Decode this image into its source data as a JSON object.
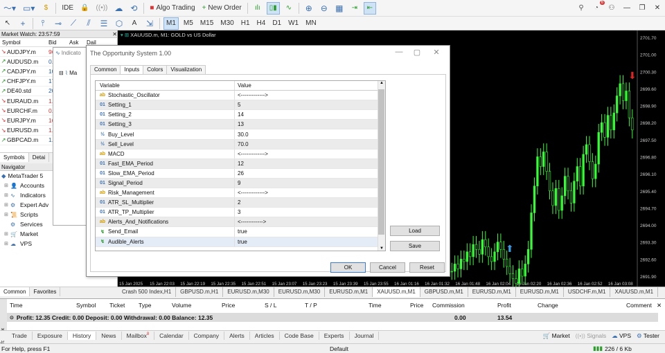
{
  "toolbar": {
    "ide_label": "IDE",
    "algo_trading_label": "Algo Trading",
    "new_order_label": "New Order",
    "notification_count": "6",
    "timeframes": [
      "M1",
      "M5",
      "M15",
      "M30",
      "H1",
      "H4",
      "D1",
      "W1",
      "MN"
    ],
    "active_timeframe": "M1"
  },
  "market_watch": {
    "title": "Market Watch: 23:57:59",
    "columns": [
      "Symbol",
      "Bid",
      "Ask",
      "Dail"
    ],
    "rows": [
      {
        "symbol": "AUDJPY.m",
        "bid": "96",
        "dir": "down"
      },
      {
        "symbol": "AUDUSD.m",
        "bid": "0.6",
        "dir": "up"
      },
      {
        "symbol": "CADJPY.m",
        "bid": "107",
        "dir": "up"
      },
      {
        "symbol": "CHFJPY.m",
        "bid": "170",
        "dir": "up"
      },
      {
        "symbol": "DE40.std",
        "bid": "20",
        "dir": "up"
      },
      {
        "symbol": "EURAUD.m",
        "bid": "1.6",
        "dir": "down"
      },
      {
        "symbol": "EURCHF.m",
        "bid": "0.9",
        "dir": "down"
      },
      {
        "symbol": "EURJPY.m",
        "bid": "160",
        "dir": "down"
      },
      {
        "symbol": "EURUSD.m",
        "bid": "1.0",
        "dir": "down"
      },
      {
        "symbol": "GBPCAD.m",
        "bid": "1.7",
        "dir": "up"
      }
    ],
    "tabs": [
      "Symbols",
      "Detai"
    ]
  },
  "navigator": {
    "title": "Navigator",
    "root": "MetaTrader 5",
    "items": [
      "Accounts",
      "Indicators",
      "Expert Adv",
      "Scripts",
      "Services",
      "Market",
      "VPS"
    ],
    "tabs": [
      "Common",
      "Favorites"
    ]
  },
  "indicators_window": {
    "title": "Indicato",
    "item": "Ma"
  },
  "chart": {
    "header": "XAUUSD.m, M1: GOLD vs US Dollar",
    "price_labels": [
      "2701.70",
      "2701.00",
      "2700.30",
      "2699.60",
      "2698.90",
      "2698.20",
      "2697.50",
      "2696.80",
      "2696.10",
      "2695.40",
      "2694.70",
      "2694.00",
      "2693.30",
      "2692.60",
      "2691.90"
    ],
    "time_labels": [
      "15 Jan 2025",
      "15 Jan 22:03",
      "15 Jan 22:19",
      "15 Jan 22:35",
      "15 Jan 22:51",
      "15 Jan 23:07",
      "15 Jan 23:23",
      "15 Jan 23:39",
      "15 Jan 23:55",
      "16 Jan 01:16",
      "16 Jan 01:32",
      "16 Jan 01:48",
      "16 Jan 02:04",
      "16 Jan 02:20",
      "16 Jan 02:36",
      "16 Jan 02:52",
      "16 Jan 03:08"
    ],
    "series_close": [
      2692.1,
      2692.4,
      2692.2,
      2692.6,
      2692.5,
      2692.9,
      2692.7,
      2693.2,
      2693.0,
      2692.8,
      2693.4,
      2693.1,
      2692.7,
      2692.5,
      2692.9,
      2693.3,
      2693.0,
      2692.6,
      2692.3,
      2692.0,
      2691.8,
      2691.6,
      2692.2,
      2691.9,
      2692.4,
      2693.0,
      2694.5,
      2695.6,
      2696.8,
      2696.4,
      2697.0,
      2696.2,
      2695.4,
      2694.8,
      2695.5,
      2694.6,
      2695.2,
      2696.0,
      2695.4,
      2694.9,
      2695.8,
      2696.4,
      2695.6,
      2696.9,
      2697.3,
      2696.6,
      2695.9,
      2696.5,
      2697.8,
      2698.2,
      2697.6,
      2698.5,
      2697.9,
      2698.6,
      2699.3,
      2699.8,
      2699.1,
      2699.5,
      2698.4,
      2697.9
    ]
  },
  "chart_tabs": {
    "items": [
      "Crash 500 Index,H1",
      "GBPUSD.m,H1",
      "EURUSD.m,M30",
      "EURUSD.m,M30",
      "EURUSD.m,M1",
      "XAUUSD.m,M1",
      "GBPUSD.m,M1",
      "EURUSD.m,M1",
      "EURUSD.m,M1",
      "USDCHF.m,M1",
      "XAUUSD.m,M1"
    ],
    "active_index": 5
  },
  "dialog": {
    "title": "The Opportunity System 1.00",
    "tabs": [
      "Common",
      "Inputs",
      "Colors",
      "Visualization"
    ],
    "active_tab": "Inputs",
    "col_variable": "Variable",
    "col_value": "Value",
    "rows": [
      {
        "type": "ab",
        "name": "Stochastic_Oscillator",
        "value": "<------------->"
      },
      {
        "type": "01",
        "name": "Setting_1",
        "value": "5"
      },
      {
        "type": "01",
        "name": "Setting_2",
        "value": "14"
      },
      {
        "type": "01",
        "name": "Setting_3",
        "value": "13"
      },
      {
        "type": "½",
        "name": "Buy_Level",
        "value": "30.0"
      },
      {
        "type": "½",
        "name": "Sell_Level",
        "value": "70.0"
      },
      {
        "type": "ab",
        "name": "MACD",
        "value": "<------------->"
      },
      {
        "type": "01",
        "name": "Fast_EMA_Period",
        "value": "12"
      },
      {
        "type": "01",
        "name": "Slow_EMA_Period",
        "value": "26"
      },
      {
        "type": "01",
        "name": "Signal_Period",
        "value": "9"
      },
      {
        "type": "ab",
        "name": "Risk_Management",
        "value": "<------------->"
      },
      {
        "type": "01",
        "name": "ATR_SL_Multiplier",
        "value": "2"
      },
      {
        "type": "01",
        "name": "ATR_TP_Multiplier",
        "value": "3"
      },
      {
        "type": "ab",
        "name": "Alerts_And_Notifications",
        "value": "<------------>"
      },
      {
        "type": "bool",
        "name": "Send_Email",
        "value": "true"
      },
      {
        "type": "bool",
        "name": "Audible_Alerts",
        "value": "true"
      }
    ],
    "load_label": "Load",
    "save_label": "Save",
    "ok_label": "OK",
    "cancel_label": "Cancel",
    "reset_label": "Reset"
  },
  "toolbox": {
    "columns": [
      "Time",
      "Symbol",
      "Ticket",
      "Type",
      "Volume",
      "Price",
      "S / L",
      "T / P",
      "Time",
      "Price",
      "Commission",
      "Profit",
      "Change",
      "Comment"
    ],
    "balance_line": "Profit: 12.35  Credit: 0.00  Deposit: 0.00  Withdrawal: 0.00  Balance: 12.35",
    "commission_total": "0.00",
    "profit_total": "13.54",
    "side_label": "Toolbox",
    "tabs": [
      "Trade",
      "Exposure",
      "History",
      "News",
      "Mailbox",
      "Calendar",
      "Company",
      "Alerts",
      "Articles",
      "Code Base",
      "Experts",
      "Journal"
    ],
    "active_tab": "History",
    "mailbox_badge": "8",
    "right_items": [
      "Market",
      "Signals",
      "VPS",
      "Tester"
    ]
  },
  "status": {
    "help": "For Help, press F1",
    "profile": "Default",
    "traffic": "226 / 6 Kb"
  }
}
